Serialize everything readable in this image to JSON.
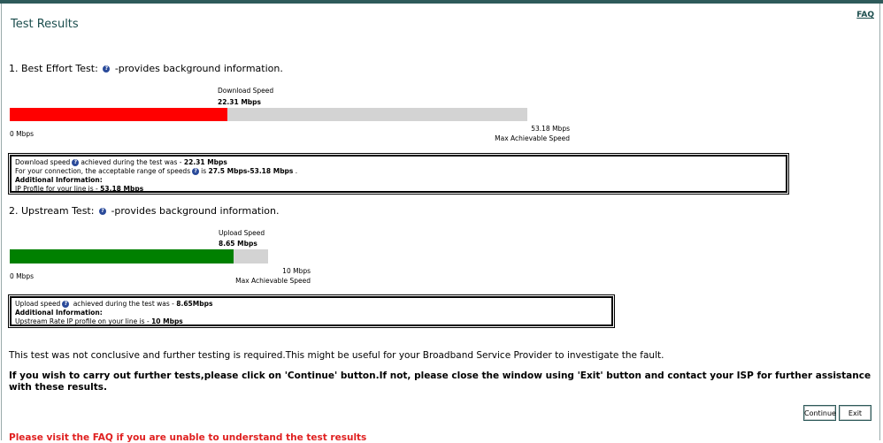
{
  "header": {
    "title": "Test Results",
    "faq_link": "FAQ"
  },
  "best_effort": {
    "heading_prefix": "1. Best Effort Test:",
    "heading_suffix": "-provides background information.",
    "speed_label": "Download Speed",
    "speed_value": "22.31 Mbps",
    "min_label": "0 Mbps",
    "max_value": "53.18 Mbps",
    "max_label": "Max Achievable Speed",
    "fill_fraction": 0.4197,
    "fill_color": "#ff0000",
    "info": {
      "line1_a": "Download speed",
      "line1_b": "achieved during the test was - ",
      "line1_value": "22.31 Mbps",
      "line2_a": "For your connection, the acceptable range of speeds",
      "line2_b": "is ",
      "line2_value": "27.5 Mbps-53.18 Mbps",
      "line2_end": " .",
      "additional": "Additional Information:",
      "line4_a": "IP Profile for your line is - ",
      "line4_value": "53.18 Mbps"
    }
  },
  "upstream": {
    "heading_prefix": "2. Upstream Test:",
    "heading_suffix": "-provides background information.",
    "speed_label": "Upload Speed",
    "speed_value": "8.65 Mbps",
    "min_label": "0 Mbps",
    "max_value": "10 Mbps",
    "max_label": "Max Achievable Speed",
    "fill_fraction": 0.865,
    "fill_color": "#008000",
    "info": {
      "line1_a": "Upload speed",
      "line1_b": " achieved during the test was - ",
      "line1_value": "8.65Mbps",
      "additional": "Additional Information:",
      "line3_a": "Upstream Rate IP profile on your line is - ",
      "line3_value": "10 Mbps"
    }
  },
  "messages": {
    "inconclusive": "This test was not conclusive and further testing is required.This might be useful for your Broadband Service Provider to investigate the fault.",
    "instruction": "If you wish to carry out further tests,please click on 'Continue' button.If not, please close the window using 'Exit' button and contact your ISP for further assistance with these results.",
    "bottom_partial": "Please visit the FAQ if you are unable to understand the test results"
  },
  "buttons": {
    "continue": "Continue",
    "exit": "Exit"
  },
  "icons": {
    "help": "question-help-icon"
  }
}
